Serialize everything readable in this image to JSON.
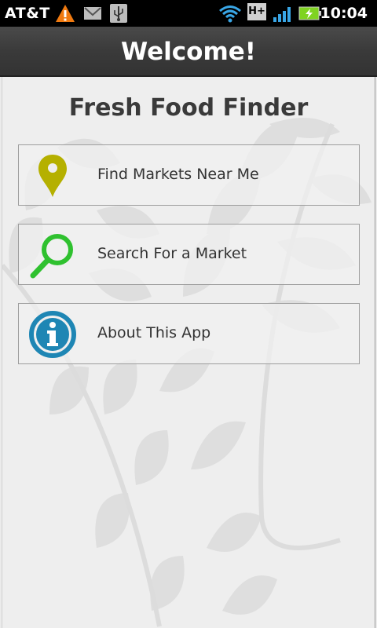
{
  "status_bar": {
    "carrier": "AT&T",
    "time": "10:04",
    "network": "H+",
    "icons": [
      "warning-icon",
      "mail-icon",
      "usb-icon",
      "wifi-icon",
      "network-type-icon",
      "signal-icon",
      "battery-charging-icon"
    ]
  },
  "title_bar": {
    "title": "Welcome!"
  },
  "main": {
    "heading": "Fresh Food Finder",
    "menu": [
      {
        "label": "Find Markets Near Me",
        "icon": "map-pin-icon"
      },
      {
        "label": "Search For a Market",
        "icon": "search-icon"
      },
      {
        "label": "About This App",
        "icon": "info-icon"
      }
    ]
  },
  "colors": {
    "pin": "#b5b000",
    "search": "#2fc12f",
    "info": "#1e86b4",
    "title_bar": "#3a3a3a"
  }
}
